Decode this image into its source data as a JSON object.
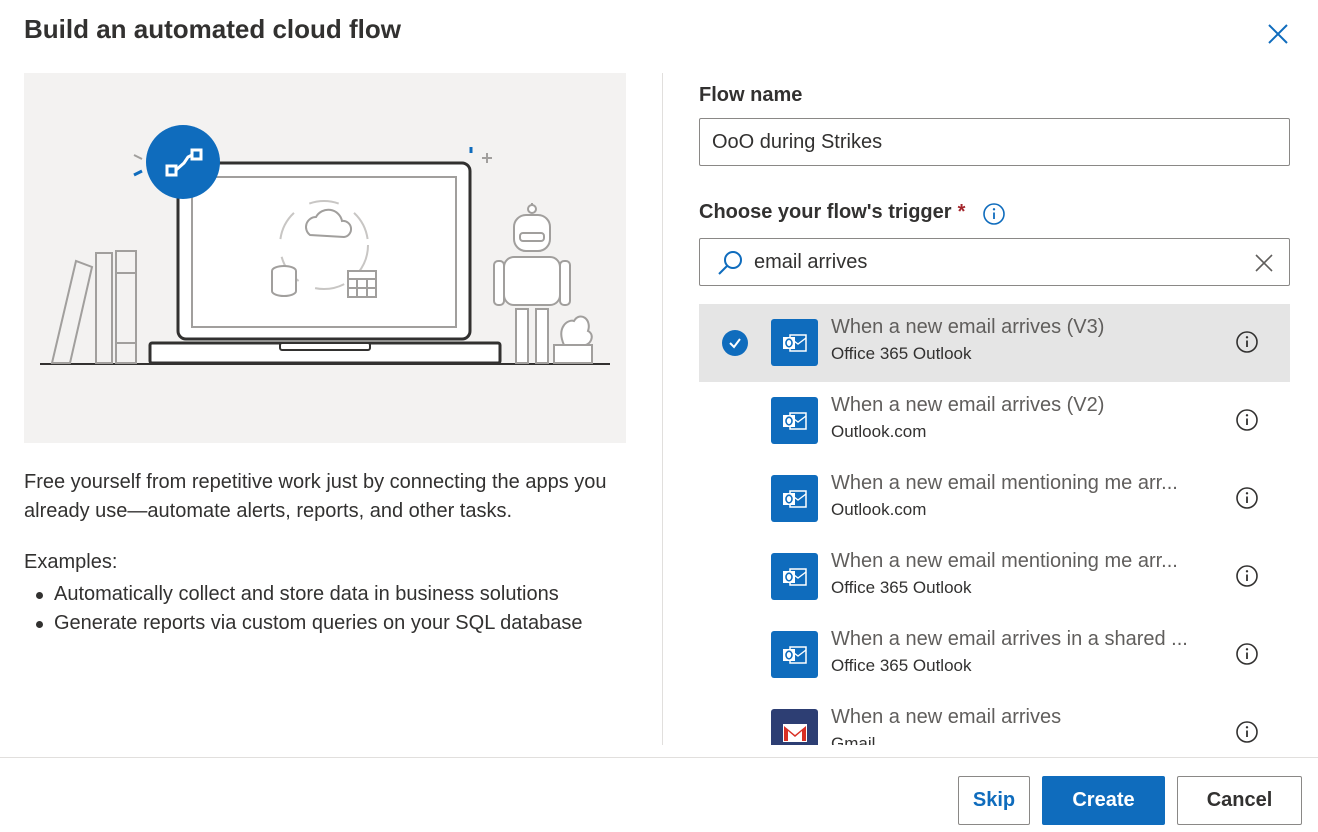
{
  "dialog": {
    "title": "Build an automated cloud flow"
  },
  "left": {
    "description": "Free yourself from repetitive work just by connecting the apps you already use—automate alerts, reports, and other tasks.",
    "examples_title": "Examples:",
    "examples": [
      "Automatically collect and store data in business solutions",
      "Generate reports via custom queries on your SQL database"
    ]
  },
  "form": {
    "flow_name_label": "Flow name",
    "flow_name_value": "OoO during Strikes",
    "trigger_label": "Choose your flow's trigger",
    "required_mark": "*",
    "search_value": "email arrives"
  },
  "triggers": [
    {
      "name": "When a new email arrives (V3)",
      "connector": "Office 365 Outlook",
      "icon": "outlook-icon",
      "selected": true
    },
    {
      "name": "When a new email arrives (V2)",
      "connector": "Outlook.com",
      "icon": "outlook-icon",
      "selected": false
    },
    {
      "name": "When a new email mentioning me arr...",
      "connector": "Outlook.com",
      "icon": "outlook-icon",
      "selected": false
    },
    {
      "name": "When a new email mentioning me arr...",
      "connector": "Office 365 Outlook",
      "icon": "outlook-icon",
      "selected": false
    },
    {
      "name": "When a new email arrives in a shared ...",
      "connector": "Office 365 Outlook",
      "icon": "outlook-icon",
      "selected": false
    },
    {
      "name": "When a new email arrives",
      "connector": "Gmail",
      "icon": "gmail-icon",
      "selected": false
    }
  ],
  "footer": {
    "skip_label": "Skip",
    "create_label": "Create",
    "cancel_label": "Cancel"
  },
  "colors": {
    "accent": "#0f6cbd",
    "selected_row": "#e5e5e5",
    "required": "#a4262c"
  }
}
